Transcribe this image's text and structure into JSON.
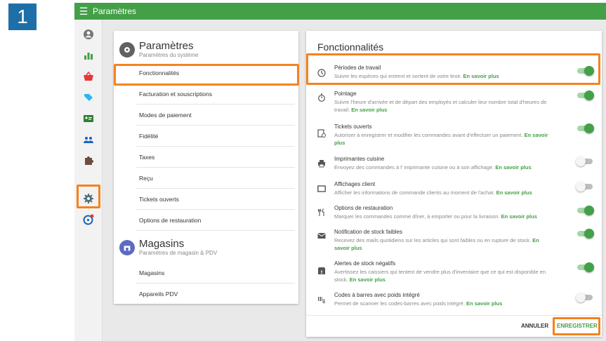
{
  "step_badge": "1",
  "topbar": {
    "title": "Paramètres"
  },
  "settings": {
    "title": "Paramètres",
    "subtitle": "Paramètres du système",
    "items": [
      "Fonctionnalités",
      "Facturation et souscriptions",
      "Modes de paiement",
      "Fidélité",
      "Taxes",
      "Reçu",
      "Tickets ouverts",
      "Options de restauration"
    ]
  },
  "stores": {
    "title": "Magasins",
    "subtitle": "Paramètres de magasin & PDV",
    "items": [
      "Magasins",
      "Appareils PDV"
    ]
  },
  "features": {
    "title": "Fonctionnalités",
    "link_label": "En savoir plus",
    "rows": [
      {
        "icon": "clock-icon",
        "name": "Périodes de travail",
        "desc": "Suivre les espèces qui entrent et sortent de votre tiroir.",
        "enabled": true
      },
      {
        "icon": "stopwatch-icon",
        "name": "Pointage",
        "desc": "Suivre l'heure d'arrivée et de départ des employés et calculer leur nombre total d'heures de travail.",
        "enabled": true
      },
      {
        "icon": "open-ticket-icon",
        "name": "Tickets ouverts",
        "desc": "Autoriser à enregistrer et modifier les commandes avant d'effectuer un paiement.",
        "enabled": true
      },
      {
        "icon": "printer-icon",
        "name": "Imprimantes cuisine",
        "desc": "Envoyez des commandes à l' imprimante cuisine ou à son affichage.",
        "enabled": false
      },
      {
        "icon": "display-icon",
        "name": "Affichages client",
        "desc": "Afficher les informations de commande clients au moment de l'achat.",
        "enabled": false
      },
      {
        "icon": "cutlery-icon",
        "name": "Options de restauration",
        "desc": "Marquer les commandes comme dîner, à emporter ou pour la livraison.",
        "enabled": true
      },
      {
        "icon": "mail-icon",
        "name": "Notification de stock faibles",
        "desc": "Recevez des mails quotidiens sur les articles qui sont faibles ou en rupture de stock.",
        "enabled": true
      },
      {
        "icon": "store-alert-icon",
        "name": "Alertes de stock négatifs",
        "desc": "Avertissez les caissiers qui tentent de vendre plus d'inventaire que ce qui est disponible en stock.",
        "enabled": true
      },
      {
        "icon": "barcode-icon",
        "name": "Codes à barres avec poids intégré",
        "desc": "Permet de scanner les codes-barres avec poids intégré.",
        "enabled": false
      }
    ],
    "cancel_label": "ANNULER",
    "save_label": "ENREGISTRER"
  },
  "colors": {
    "accent": "#43a047",
    "highlight": "#f5821f",
    "badge": "#1e6fa8"
  }
}
